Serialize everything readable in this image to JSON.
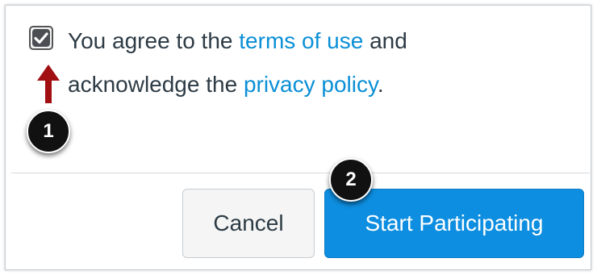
{
  "agreement": {
    "checked": true,
    "text_before": "You agree to the ",
    "terms_link": "terms of use",
    "text_middle": " and acknowledge the ",
    "privacy_link": "privacy policy",
    "text_after": "."
  },
  "callouts": {
    "badge_1": "1",
    "badge_2": "2",
    "arrow_color": "#a10f13"
  },
  "footer": {
    "cancel_label": "Cancel",
    "start_label": "Start Participating"
  },
  "colors": {
    "link": "#0a8fd6",
    "primary_button": "#0e8ee0",
    "text": "#2d3b45"
  }
}
